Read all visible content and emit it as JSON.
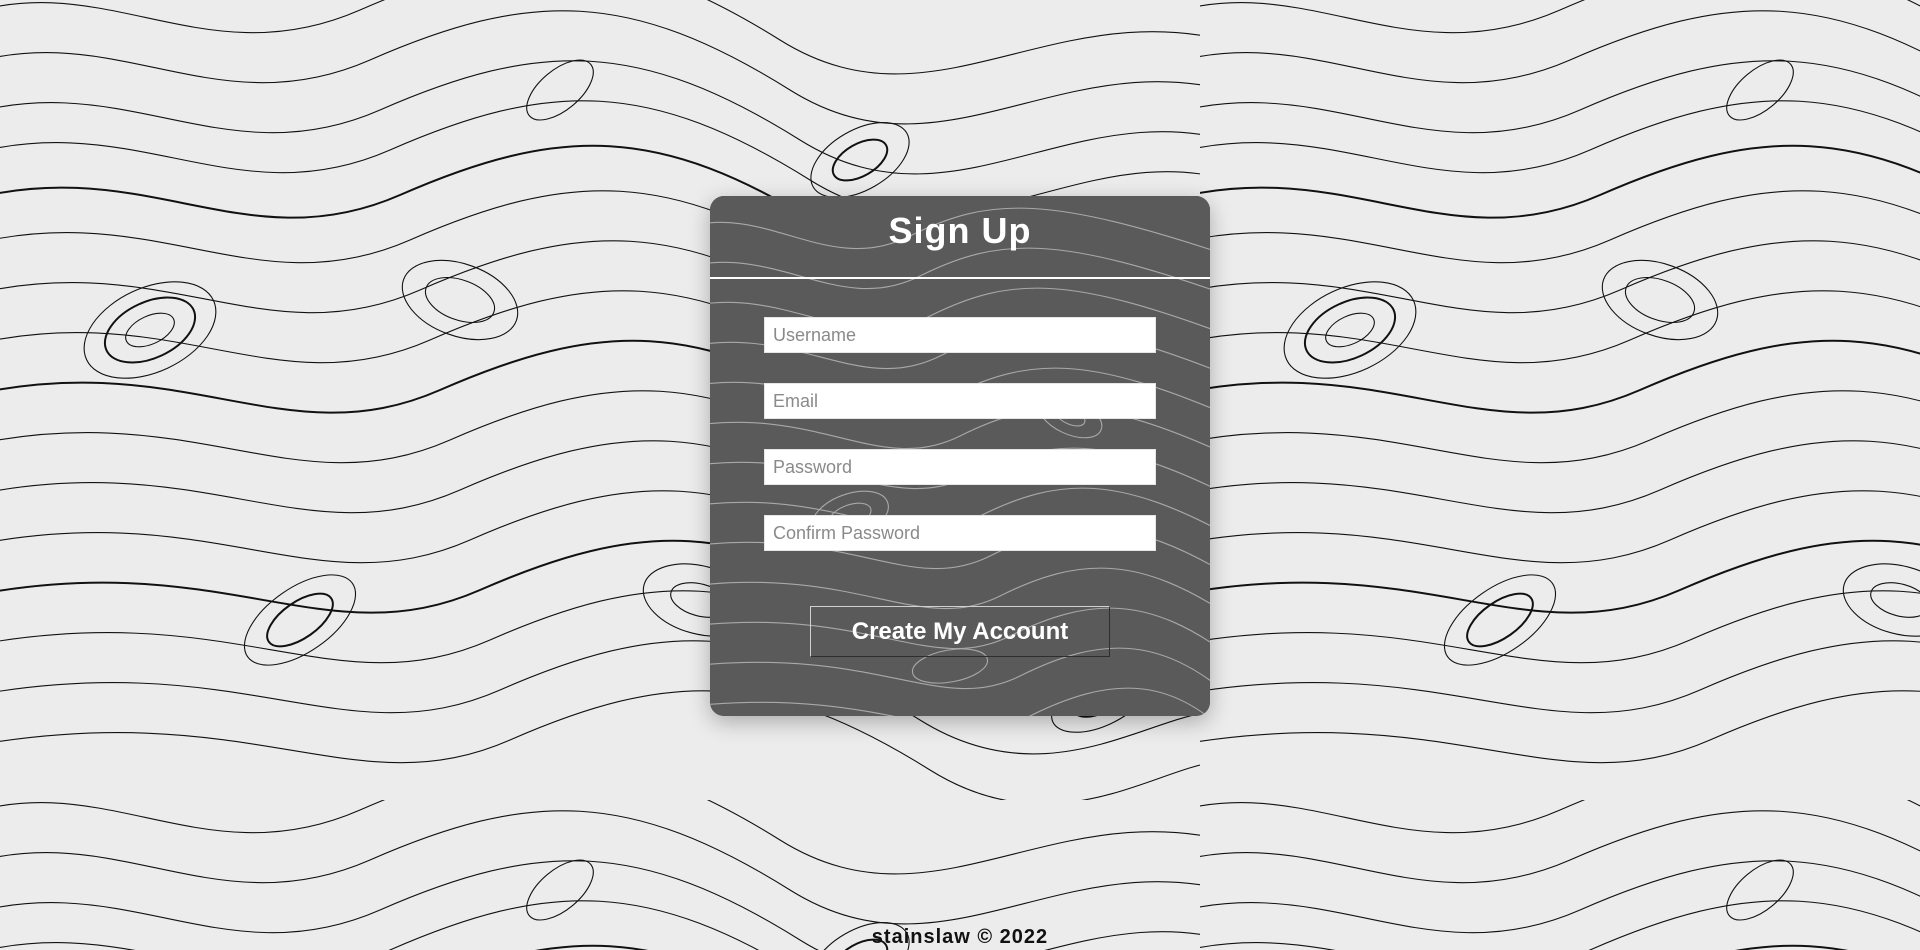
{
  "signup": {
    "title": "Sign Up",
    "username_placeholder": "Username",
    "email_placeholder": "Email",
    "password_placeholder": "Password",
    "confirm_password_placeholder": "Confirm Password",
    "submit_label": "Create My Account"
  },
  "footer": {
    "text": "stainslaw © 2022"
  },
  "colors": {
    "page_background": "#ececec",
    "contour_lines": "#111111",
    "card_background": "#5a5a5a",
    "card_contours": "#a8a8a8",
    "text_light": "#ffffff"
  },
  "icons": {
    "background": "topographic-contour-pattern",
    "card_background": "topographic-contour-pattern"
  }
}
